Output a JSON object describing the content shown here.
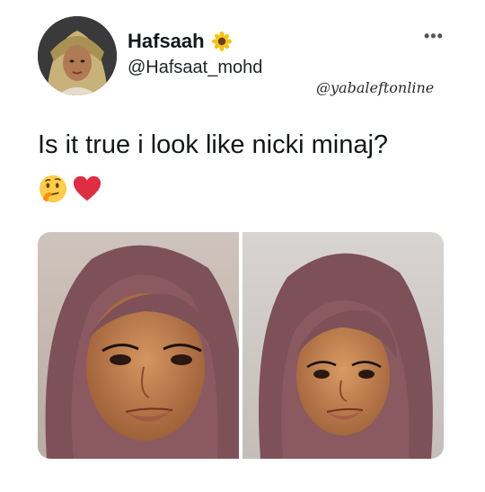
{
  "author": {
    "display_name": "Hafsaah",
    "handle": "@Hafsaat_mohd",
    "badge_icon": "sunflower-icon"
  },
  "watermark": "@yabaleftonline",
  "tweet": {
    "text": "Is it true i look like nicki minaj?",
    "emojis": [
      "thinking-face-emoji",
      "red-heart-emoji"
    ]
  },
  "media": {
    "photo_count": 2
  },
  "colors": {
    "text": "#14171a",
    "hijab": "#8a5a60",
    "skin": "#b8764a",
    "heart": "#e0245e"
  }
}
